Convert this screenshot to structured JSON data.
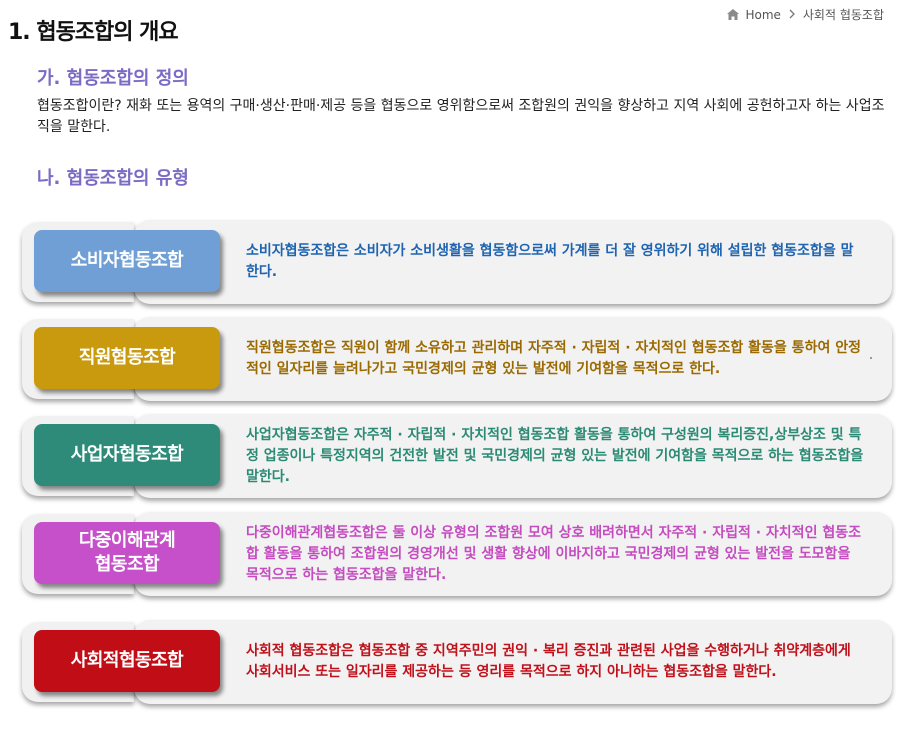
{
  "header": {
    "title": "1. 협동조합의 개요",
    "breadcrumb": {
      "home": "Home",
      "current": "사회적 협동조합"
    }
  },
  "sections": {
    "definition": {
      "heading": "가. 협동조합의 정의",
      "text": "협동조합이란? 재화 또는 용역의 구매·생산·판매·제공 등을 협동으로 영위함으로써 조합원의 권익을 향상하고 지역 사회에 공헌하고자 하는 사업조직을 말한다."
    },
    "types": {
      "heading": "나. 협동조합의 유형",
      "items": [
        {
          "label": "소비자협동조합",
          "color": "#6f9fd4",
          "text_color": "#1f64b0",
          "description": "소비자협동조합은 소비자가 소비생활을 협동함으로써 가계를 더 잘 영위하기 위해 설립한 협동조합을 말한다."
        },
        {
          "label": "직원협동조합",
          "color": "#c99a0e",
          "text_color": "#9a6a00",
          "description": "직원협동조합은 직원이 함께 소유하고 관리하며 자주적 · 자립적 · 자치적인 협동조합 활동을 통하여 안정적인 일자리를 늘려나가고 국민경제의 균형 있는 발전에 기여함을 목적으로 한다."
        },
        {
          "label": "사업자협동조합",
          "color": "#2e8b79",
          "text_color": "#2a8a73",
          "description": "사업자협동조합은 자주적 · 자립적 · 자치적인 협동조합 활동을 통하여 구성원의 복리증진,상부상조 및 특정 업종이나 특정지역의 건전한 발전 및 국민경제의 균형 있는 발전에 기여함을 목적으로 하는 협동조합을 말한다."
        },
        {
          "label": "다중이해관계\n협동조합",
          "color": "#c550c9",
          "text_color": "#c44bc0",
          "description": "다중이해관계협동조합은 둘 이상 유형의 조합원 모여 상호 배려하면서 자주적 · 자립적 · 자치적인 협동조합 활동을 통하여 조합원의 경영개선 및 생활 향상에 이바지하고 국민경제의 균형 있는 발전을 도모함을 목적으로 하는 협동조합을 말한다."
        },
        {
          "label": "사회적협동조합",
          "color": "#c00d16",
          "text_color": "#c0101a",
          "description": "사회적 협동조합은 협동조합 중 지역주민의 권익 · 복리 증진과 관련된 사업을 수행하거나 취약계층에게 사회서비스 또는 일자리를 제공하는 등 영리를 목적으로 하지 아니하는 협동조합을 말한다."
        }
      ]
    }
  }
}
